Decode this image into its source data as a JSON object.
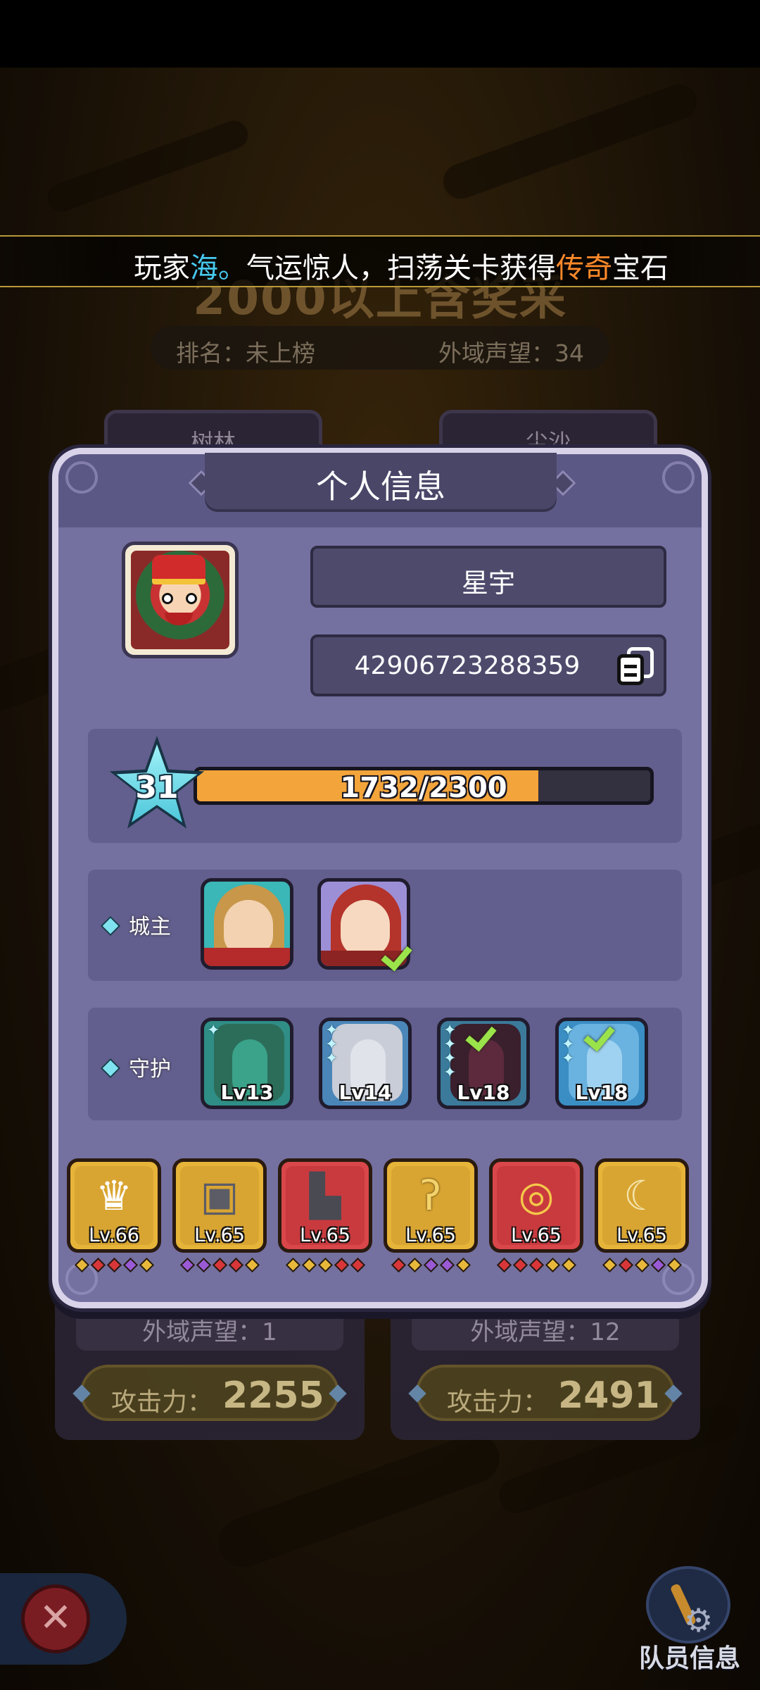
{
  "marquee": {
    "prefix": "玩家",
    "player": "海。",
    "middle": "气运惊人，扫荡关卡获得",
    "rarity": "传奇",
    "suffix": "宝石"
  },
  "background": {
    "title": "2000以上含奖采",
    "rank_label": "排名：未上榜",
    "fame_label": "外域声望：34",
    "tab_left": "树林",
    "tab_right": "尘沙",
    "card_left": {
      "fame": "外域声望：1",
      "attack_label": "攻击力：",
      "attack_value": "2255"
    },
    "card_right": {
      "fame": "外域声望：12",
      "attack_label": "攻击力：",
      "attack_value": "2491"
    },
    "close_symbol": "✕",
    "team_info_label": "队员信息"
  },
  "dialog": {
    "title": "个人信息",
    "player_name": "星宇",
    "player_id": "42906723288359",
    "level": "31",
    "xp_text": "1732/2300",
    "xp_progress": 0.753,
    "lord_label": "城主",
    "guard_label": "守护",
    "lords": [
      {
        "name": "lord-1",
        "selected": false
      },
      {
        "name": "lord-2",
        "selected": true
      }
    ],
    "guardians": [
      {
        "level": "Lv13",
        "stars": 1,
        "selected": false
      },
      {
        "level": "Lv14",
        "stars": 3,
        "selected": false
      },
      {
        "level": "Lv18",
        "stars": 4,
        "selected": true
      },
      {
        "level": "Lv18",
        "stars": 3,
        "selected": true
      }
    ],
    "equipment": [
      {
        "icon": "crown-icon",
        "level": "Lv.66"
      },
      {
        "icon": "armor-icon",
        "level": "Lv.65"
      },
      {
        "icon": "boots-icon",
        "level": "Lv.65"
      },
      {
        "icon": "staff-icon",
        "level": "Lv.65"
      },
      {
        "icon": "ring-icon",
        "level": "Lv.65"
      },
      {
        "icon": "amulet-icon",
        "level": "Lv.65"
      }
    ]
  },
  "colors": {
    "accent_orange": "#f3a43a",
    "player_highlight": "#46c9f0",
    "rarity_highlight": "#ff8a2a",
    "dialog_bg": "#7470a0"
  }
}
